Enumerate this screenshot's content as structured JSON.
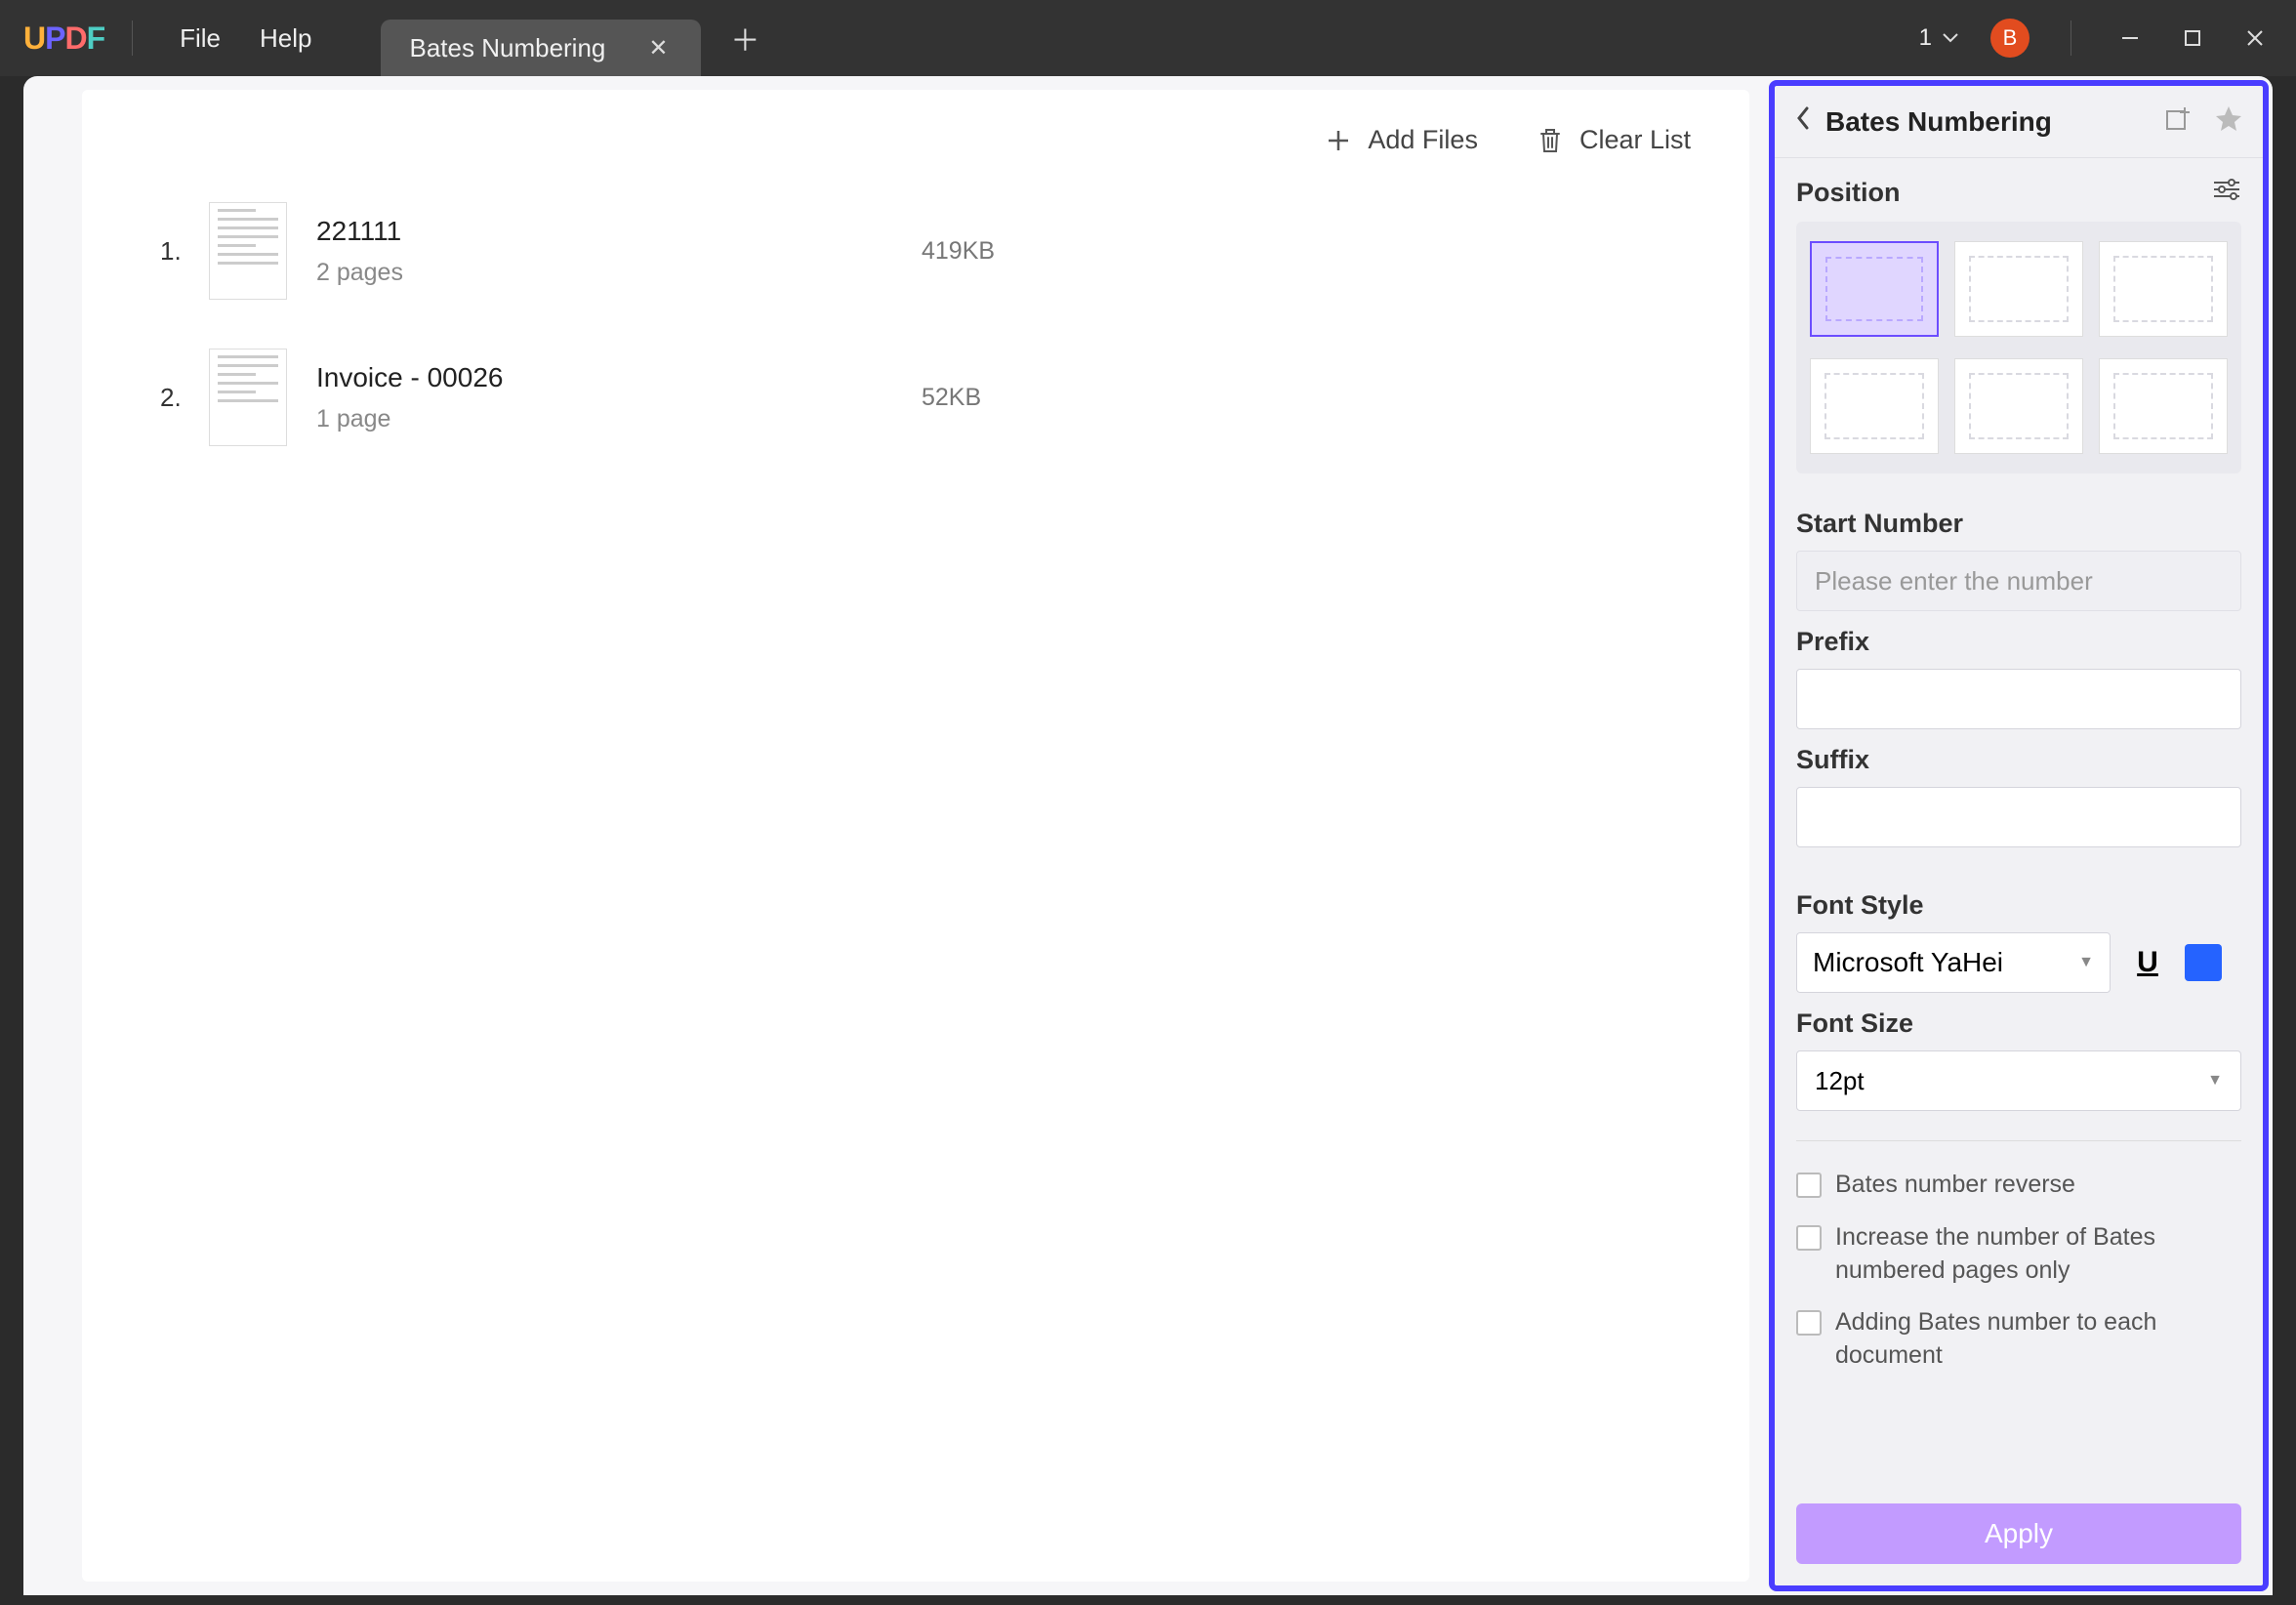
{
  "titlebar": {
    "logo": {
      "u": "U",
      "p": "P",
      "d": "D",
      "f": "F"
    },
    "menu": {
      "file": "File",
      "help": "Help"
    },
    "tab": {
      "label": "Bates Numbering"
    },
    "right": {
      "one_label": "1",
      "avatar_letter": "B"
    }
  },
  "toolbar": {
    "add_files": "Add Files",
    "clear_list": "Clear List"
  },
  "files": [
    {
      "index": "1.",
      "name": "221111",
      "pages": "2 pages",
      "size": "419KB"
    },
    {
      "index": "2.",
      "name": "Invoice - 00026",
      "pages": "1 page",
      "size": "52KB"
    }
  ],
  "panel": {
    "title": "Bates Numbering",
    "position_label": "Position",
    "start_number_label": "Start Number",
    "start_number_placeholder": "Please enter the number",
    "prefix_label": "Prefix",
    "suffix_label": "Suffix",
    "font_style_label": "Font Style",
    "font_style_value": "Microsoft YaHei",
    "underline_glyph": "U",
    "font_color": "#2563ff",
    "font_size_label": "Font Size",
    "font_size_value": "12pt",
    "checkboxes": {
      "reverse": "Bates number reverse",
      "numbered_only": "Increase the number of Bates numbered pages only",
      "each_document": "Adding Bates number to each document"
    },
    "apply": "Apply"
  }
}
